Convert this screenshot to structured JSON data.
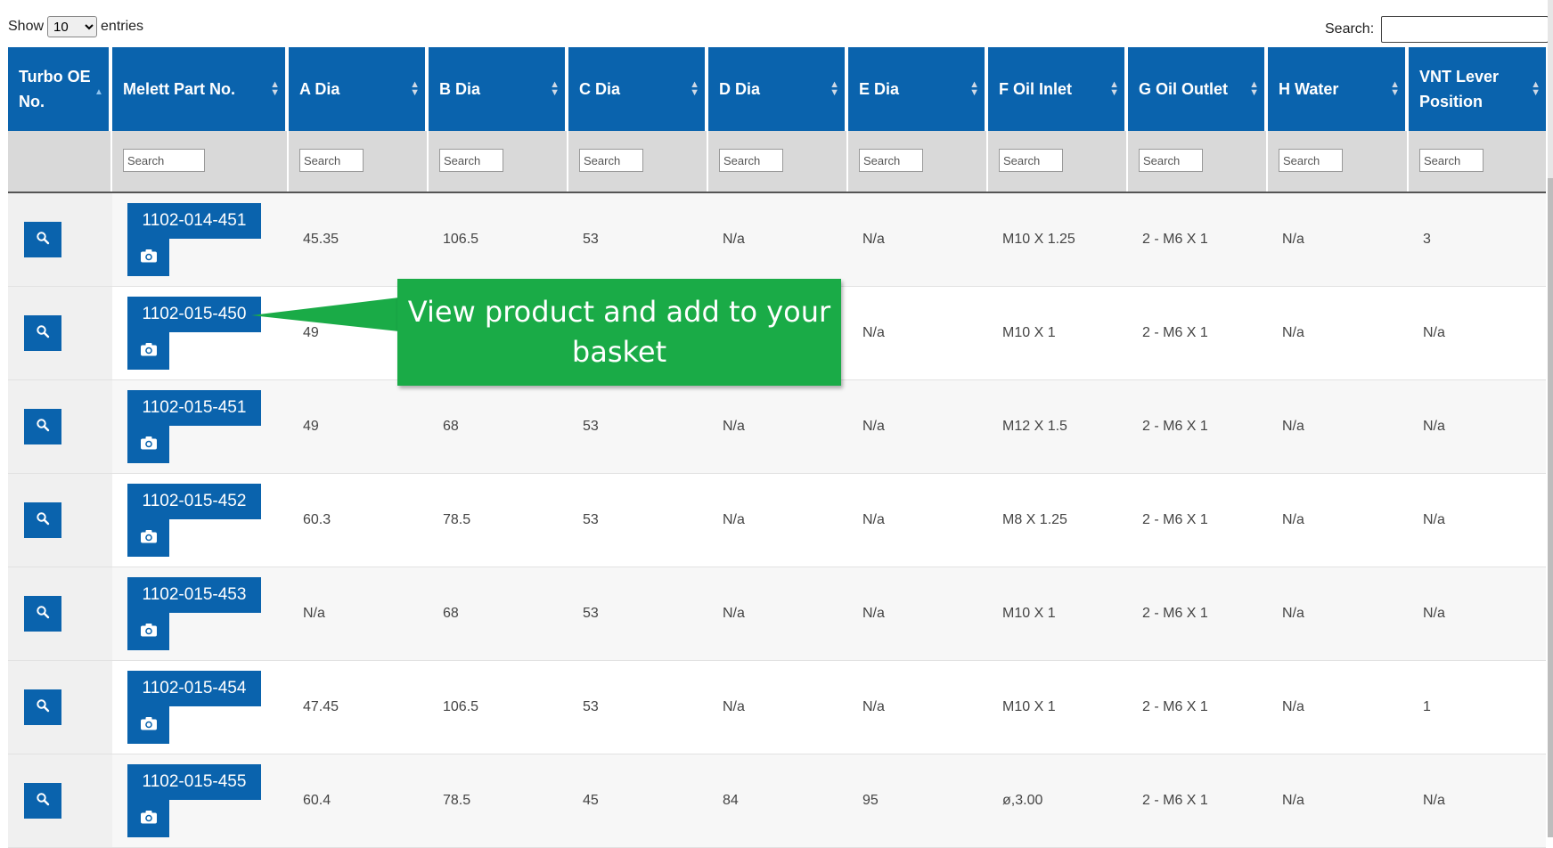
{
  "controls": {
    "show_label": "Show",
    "entries_value": "10",
    "entries_label": "entries",
    "search_label": "Search:"
  },
  "columns": [
    {
      "label": "Turbo OE No.",
      "filter": ""
    },
    {
      "label": "Melett Part No.",
      "filter": "Search"
    },
    {
      "label": "A Dia",
      "filter": "Search"
    },
    {
      "label": "B Dia",
      "filter": "Search"
    },
    {
      "label": "C Dia",
      "filter": "Search"
    },
    {
      "label": "D Dia",
      "filter": "Search"
    },
    {
      "label": "E Dia",
      "filter": "Search"
    },
    {
      "label": "F Oil Inlet",
      "filter": "Search"
    },
    {
      "label": "G Oil Outlet",
      "filter": "Search"
    },
    {
      "label": "H Water",
      "filter": "Search"
    },
    {
      "label": "VNT Lever Position",
      "filter": "Search"
    }
  ],
  "rows": [
    {
      "part": "1102-014-451",
      "a": "45.35",
      "b": "106.5",
      "c": "53",
      "d": "N/a",
      "e": "N/a",
      "f": "M10 X 1.25",
      "g": "2 - M6 X 1",
      "h": "N/a",
      "vnt": "3"
    },
    {
      "part": "1102-015-450",
      "a": "49",
      "b": "",
      "c": "",
      "d": "",
      "e": "N/a",
      "f": "M10 X 1",
      "g": "2 - M6 X 1",
      "h": "N/a",
      "vnt": "N/a"
    },
    {
      "part": "1102-015-451",
      "a": "49",
      "b": "68",
      "c": "53",
      "d": "N/a",
      "e": "N/a",
      "f": "M12 X 1.5",
      "g": "2 - M6 X 1",
      "h": "N/a",
      "vnt": "N/a"
    },
    {
      "part": "1102-015-452",
      "a": "60.3",
      "b": "78.5",
      "c": "53",
      "d": "N/a",
      "e": "N/a",
      "f": "M8 X 1.25",
      "g": "2 - M6 X 1",
      "h": "N/a",
      "vnt": "N/a"
    },
    {
      "part": "1102-015-453",
      "a": "N/a",
      "b": "68",
      "c": "53",
      "d": "N/a",
      "e": "N/a",
      "f": "M10 X 1",
      "g": "2 - M6 X 1",
      "h": "N/a",
      "vnt": "N/a"
    },
    {
      "part": "1102-015-454",
      "a": "47.45",
      "b": "106.5",
      "c": "53",
      "d": "N/a",
      "e": "N/a",
      "f": "M10 X 1",
      "g": "2 - M6 X 1",
      "h": "N/a",
      "vnt": "1"
    },
    {
      "part": "1102-015-455",
      "a": "60.4",
      "b": "78.5",
      "c": "45",
      "d": "84",
      "e": "95",
      "f": "ø,3.00",
      "g": "2 - M6 X 1",
      "h": "N/a",
      "vnt": "N/a"
    }
  ],
  "callout": {
    "text": "View product and add to your basket"
  },
  "icons": {
    "view": "search-icon",
    "photo": "camera-icon",
    "sort": "sort-arrows-icon"
  },
  "colors": {
    "header": "#0a63ad",
    "button": "#0a63ad",
    "callout": "#1aab47",
    "filter_row": "#d9d9d9"
  }
}
